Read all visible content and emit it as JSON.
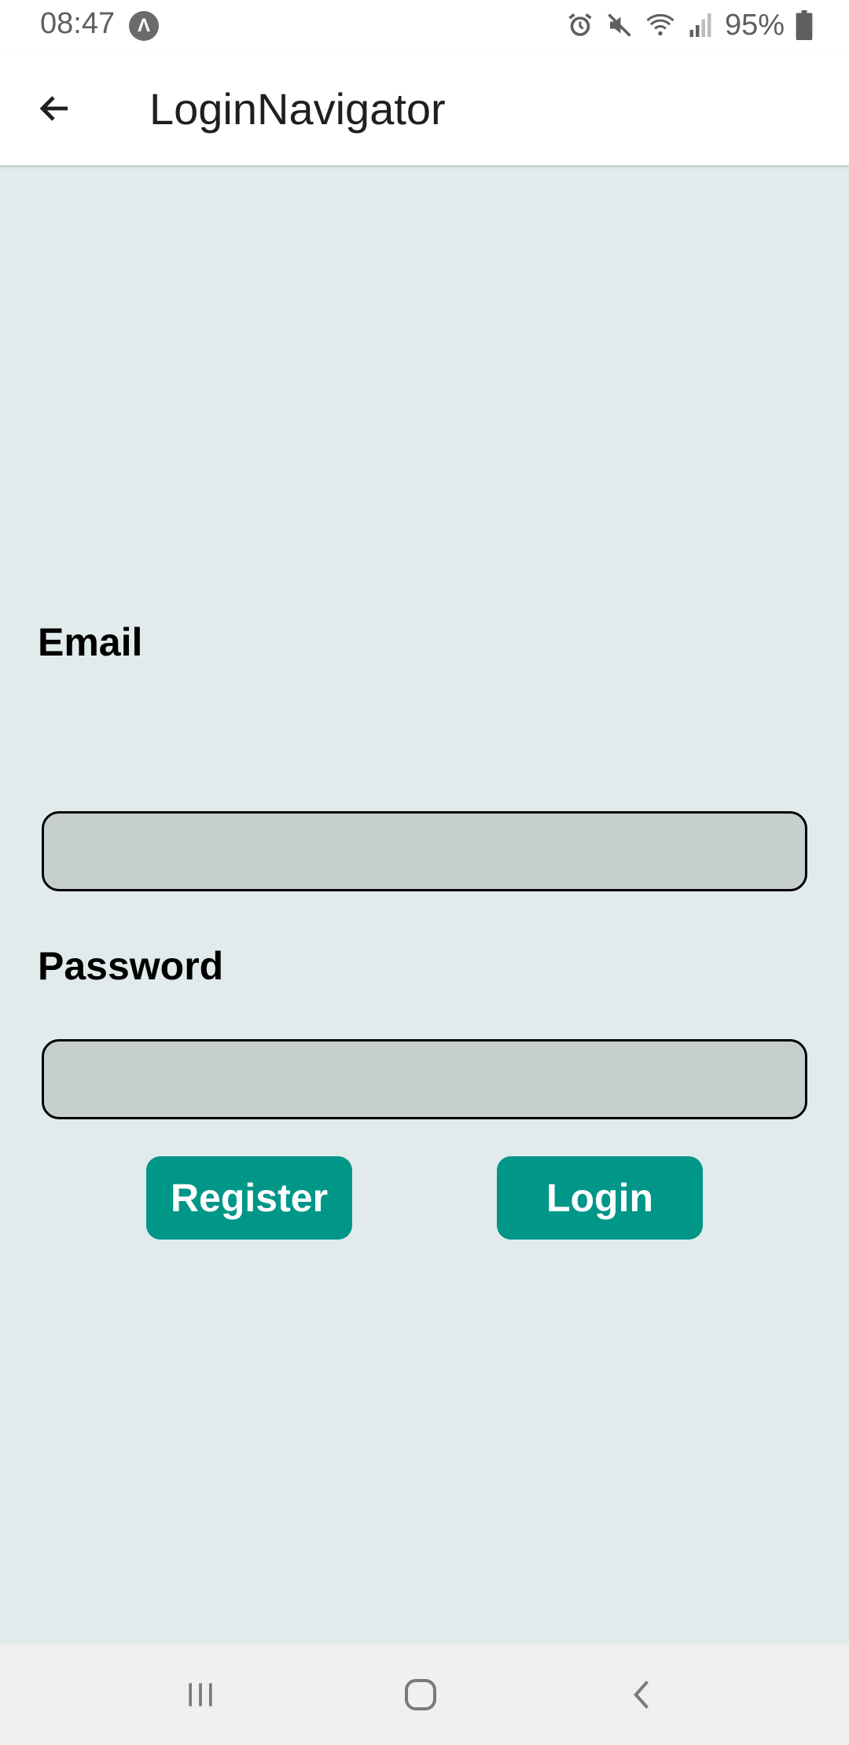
{
  "status_bar": {
    "time": "08:47",
    "app_icon_glyph": "Λ",
    "battery_percent": "95%",
    "icons": [
      "alarm-icon",
      "mute-icon",
      "wifi-icon",
      "signal-icon",
      "battery-icon"
    ]
  },
  "app_bar": {
    "title": "LoginNavigator",
    "back_icon": "arrow-left-icon"
  },
  "form": {
    "email_label": "Email",
    "email_value": "",
    "email_placeholder": "",
    "password_label": "Password",
    "password_value": "",
    "password_placeholder": "",
    "register_label": "Register",
    "login_label": "Login"
  },
  "nav_bar": {
    "icons": [
      "recent-apps-icon",
      "home-icon",
      "back-icon"
    ]
  },
  "colors": {
    "background": "#e2ebec",
    "input_fill": "#c6cfce",
    "button": "#009688"
  }
}
